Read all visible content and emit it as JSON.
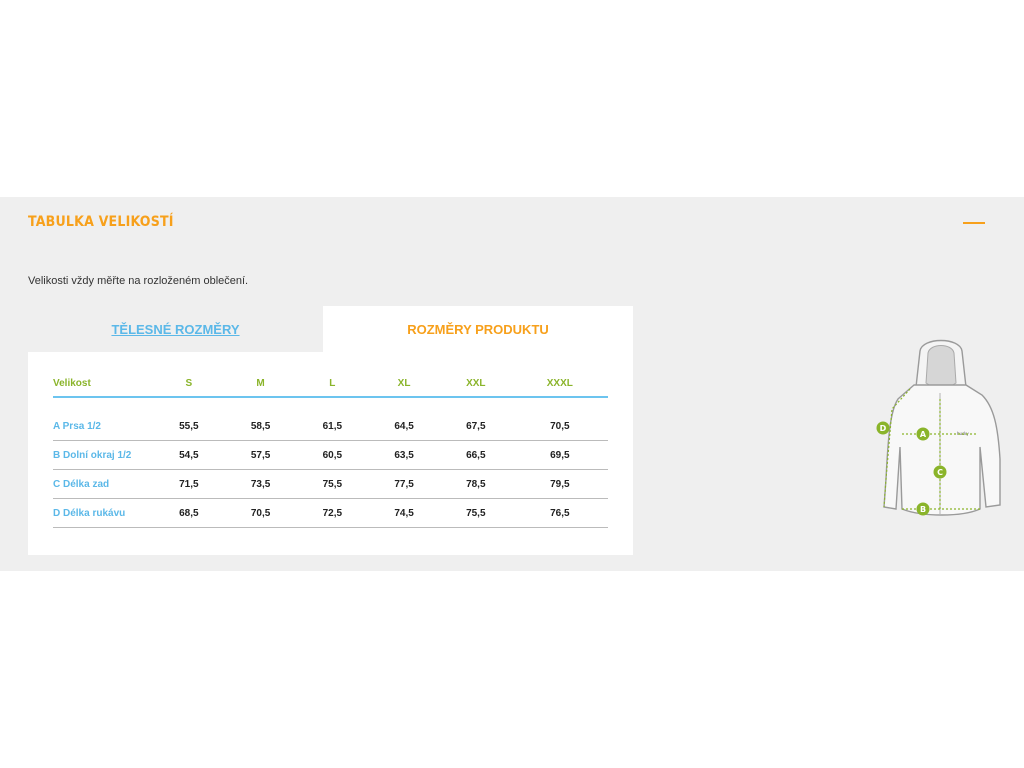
{
  "section": {
    "title": "TABULKA VELIKOSTÍ",
    "intro": "Velikosti vždy měřte na rozloženém oblečení."
  },
  "tabs": [
    {
      "label": "TĚLESNÉ ROZMĚRY",
      "active": false
    },
    {
      "label": "ROZMĚRY PRODUKTU",
      "active": true
    }
  ],
  "table": {
    "headers": [
      "Velikost",
      "S",
      "M",
      "L",
      "XL",
      "XXL",
      "XXXL"
    ],
    "rows": [
      {
        "label": "A Prsa 1/2",
        "values": [
          "55,5",
          "58,5",
          "61,5",
          "64,5",
          "67,5",
          "70,5"
        ]
      },
      {
        "label": "B Dolní okraj 1/2",
        "values": [
          "54,5",
          "57,5",
          "60,5",
          "63,5",
          "66,5",
          "69,5"
        ]
      },
      {
        "label": "C Délka zad",
        "values": [
          "71,5",
          "73,5",
          "75,5",
          "77,5",
          "78,5",
          "79,5"
        ]
      },
      {
        "label": "D Délka rukávu",
        "values": [
          "68,5",
          "70,5",
          "72,5",
          "74,5",
          "75,5",
          "76,5"
        ]
      }
    ]
  },
  "diagram": {
    "markers": [
      "D",
      "A",
      "C",
      "B"
    ],
    "accent_color": "#8ab42a"
  },
  "colors": {
    "orange": "#f7a01b",
    "blue": "#5bb8e8",
    "green": "#8ab42a",
    "panel_bg": "#efefef"
  },
  "icons": {
    "collapse": "minus-icon"
  }
}
